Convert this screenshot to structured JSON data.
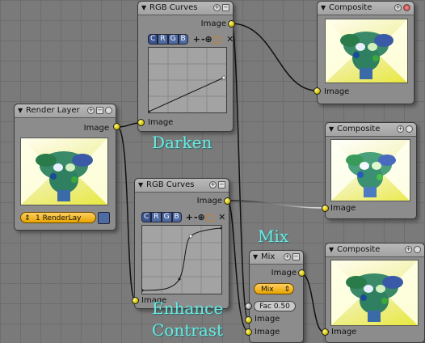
{
  "nodes": {
    "rgb_curves_top": {
      "title": "RGB Curves",
      "output_label": "Image",
      "input_label": "Image",
      "channels": [
        "C",
        "R",
        "G",
        "B"
      ],
      "tools": {
        "zoom_in": "+",
        "zoom_out": "-",
        "zoom": "⊕",
        "clip": "□",
        "close": "✕"
      }
    },
    "rgb_curves_bottom": {
      "title": "RGB Curves",
      "output_label": "Image",
      "input_label": "Image",
      "channels": [
        "C",
        "R",
        "G",
        "B"
      ],
      "tools": {
        "zoom_in": "+",
        "zoom_out": "-",
        "zoom": "⊕",
        "clip": "□",
        "close": "✕"
      }
    },
    "render_layer": {
      "title": "Render Layer",
      "output_label": "Image",
      "layer_value": "1 RenderLay"
    },
    "composite_top": {
      "title": "Composite",
      "input_label": "Image"
    },
    "composite_mid": {
      "title": "Composite",
      "input_label": "Image"
    },
    "composite_bottom": {
      "title": "Composite",
      "input_label": "Image"
    },
    "mix": {
      "title": "Mix",
      "output_label": "Image",
      "blend_mode": "Mix",
      "fac_value": "Fac 0.50",
      "input1_label": "Image",
      "input2_label": "Image"
    }
  },
  "annotations": {
    "darken": "Darken",
    "mix": "Mix",
    "enhance_line1": "Enhance",
    "enhance_line2": "Contrast"
  },
  "colors": {
    "socket_image": "#d4c400",
    "annotation": "#6ee8e0",
    "select_accent": "#e8a400"
  }
}
